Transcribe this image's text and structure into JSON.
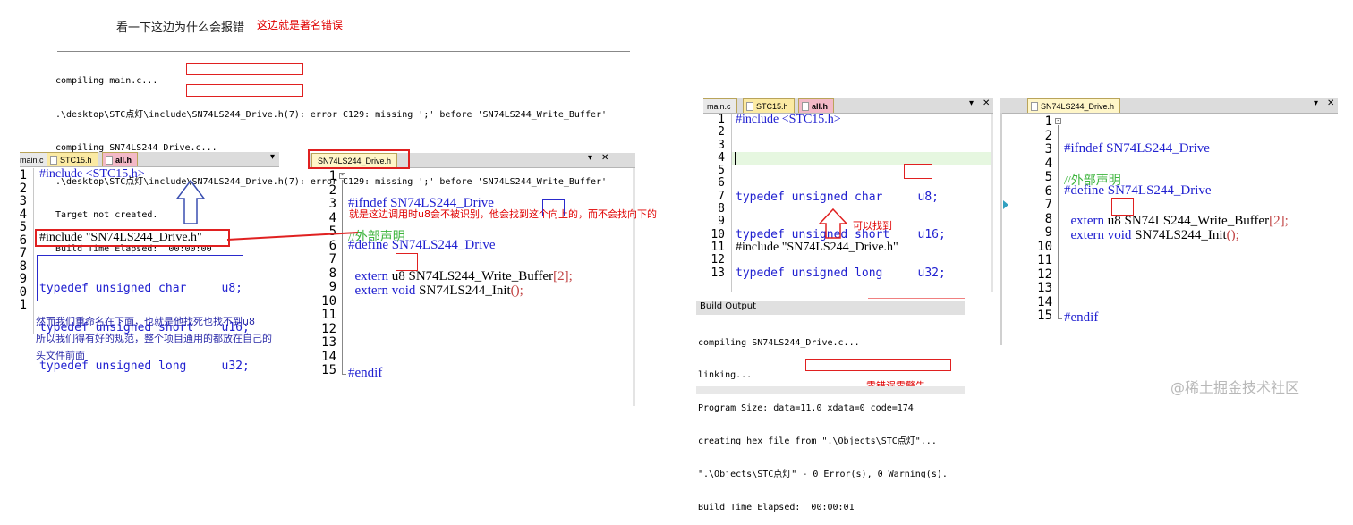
{
  "top": {
    "question": "看一下这边为什么会报错",
    "annotation": "这边就是著名错误",
    "output": [
      "compiling main.c...",
      ".\\desktop\\STC点灯\\include\\SN74LS244_Drive.h(7): error C129: missing ';' before 'SN74LS244_Write_Buffer'",
      "compiling SN74LS244_Drive.c...",
      ".\\desktop\\STC点灯\\include\\SN74LS244_Drive.h(7): error C129: missing ';' before 'SN74LS244_Write_Buffer'",
      "Target not created.",
      "Build Time Elapsed:  00:00:00"
    ]
  },
  "left_editor": {
    "tabs": [
      "main.c",
      "STC15.h",
      "all.h"
    ],
    "line_numbers": [
      "1",
      "2",
      "3",
      "4",
      "5",
      "6",
      "7",
      "8",
      "9",
      "0",
      "1"
    ],
    "line1": "#include <STC15.h>",
    "line6": "#include \"SN74LS244_Drive.h\"",
    "typedefs": [
      "typedef unsigned char     u8;",
      "typedef unsigned short    u16;",
      "typedef unsigned long     u32;"
    ],
    "note": [
      "然而我们重命名在下面，也就是他找死也找不到u8",
      "所以我们得有好的规范，整个项目通用的都放在自己的",
      "头文件前面"
    ]
  },
  "mid_editor": {
    "tab": "SN74LS244_Drive.h",
    "line_numbers": [
      "1",
      "2",
      "3",
      "4",
      "5",
      "6",
      "7",
      "8",
      "9",
      "10",
      "11",
      "12",
      "13",
      "14",
      "15"
    ],
    "ifndef": "#ifndef SN74LS244_Drive",
    "define": "#define SN74LS244_Drive",
    "comment": "//外部声明",
    "extern1_kw": "extern",
    "extern1_u8": "u8",
    "extern1_rest": "SN74LS244_Write_Buffer",
    "extern1_idx": "[2];",
    "extern2_kw": "extern",
    "extern2_void": "void",
    "extern2_rest": "SN74LS244_Init",
    "extern2_par": "();",
    "endif": "#endif",
    "annotation": "就是这边调用时u8会不被识别，他会找到这个向上的，而不会找向下的"
  },
  "right_editor1": {
    "tabs": [
      "main.c",
      "STC15.h",
      "all.h"
    ],
    "line_numbers": [
      "1",
      "2",
      "3",
      "4",
      "5",
      "6",
      "7",
      "8",
      "9",
      "10",
      "11",
      "12",
      "13"
    ],
    "line1": "#include <STC15.h>",
    "typedefs": [
      "typedef unsigned char     u8;",
      "typedef unsigned short    u16;",
      "typedef unsigned long     u32;"
    ],
    "line11": "#include \"SN74LS244_Drive.h\"",
    "annotation": "可以找到"
  },
  "build_output": {
    "title": "Build Output",
    "lines": [
      "compiling SN74LS244_Drive.c...",
      "linking...",
      "Program Size: data=11.0 xdata=0 code=174",
      "creating hex file from \".\\Objects\\STC点灯\"...",
      "\".\\Objects\\STC点灯\" - 0 Error(s), 0 Warning(s).",
      "Build Time Elapsed:  00:00:01"
    ],
    "annotation": "零错误零警告"
  },
  "right_editor2": {
    "tab": "SN74LS244_Drive.h",
    "line_numbers": [
      "1",
      "2",
      "3",
      "4",
      "5",
      "6",
      "7",
      "8",
      "9",
      "10",
      "11",
      "12",
      "13",
      "14",
      "15"
    ],
    "ifndef": "#ifndef SN74LS244_Drive",
    "define": "#define SN74LS244_Drive",
    "comment": "//外部声明",
    "extern1_kw": "extern",
    "extern1_u8": "u8",
    "extern1_rest": "SN74LS244_Write_Buffer",
    "extern1_idx": "[2];",
    "extern2_kw": "extern",
    "extern2_void": "void",
    "extern2_rest": "SN74LS244_Init",
    "extern2_par": "();",
    "endif": "#endif"
  },
  "watermark": "@稀土掘金技术社区",
  "controls": {
    "dropdown": "▾",
    "close": "✕"
  },
  "colors": {
    "red": "#e00000",
    "blue": "#2020d0",
    "green": "#3cb43c",
    "highlight": "#e6f7e0"
  }
}
